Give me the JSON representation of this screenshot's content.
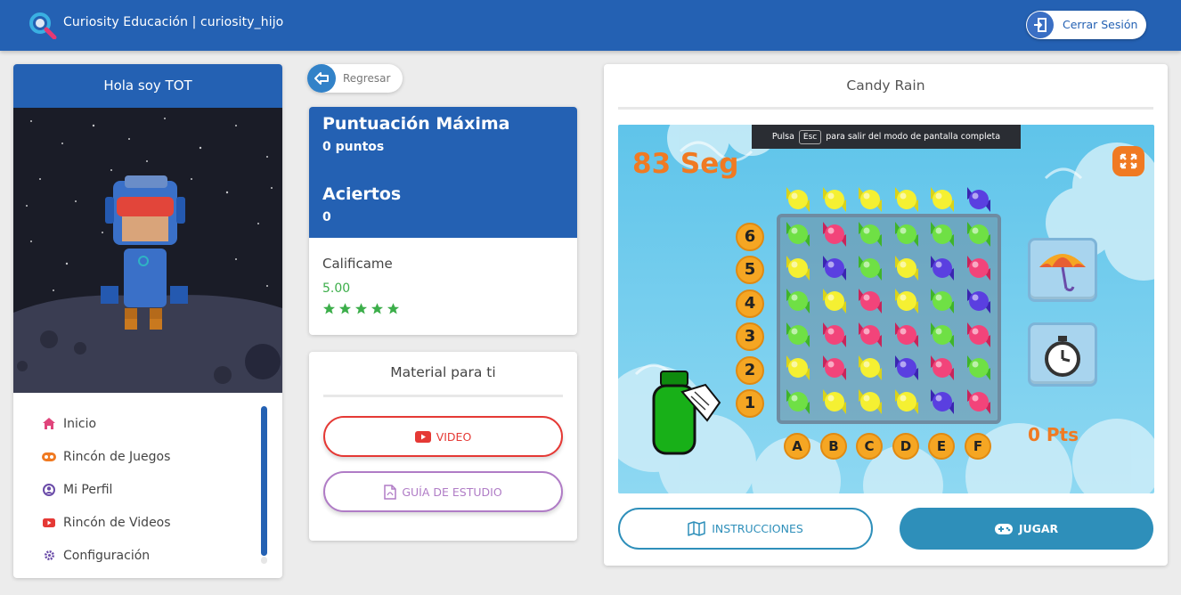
{
  "header": {
    "app_title": "Curiosity Educación | curiosity_hijo",
    "logout_label": "Cerrar Sesión"
  },
  "profile": {
    "greeting": "Hola soy TOT"
  },
  "nav": {
    "items": [
      {
        "label": "Inicio",
        "icon": "home-icon",
        "color": "#e0457b"
      },
      {
        "label": "Rincón de Juegos",
        "icon": "gamepad-icon",
        "color": "#f07a22"
      },
      {
        "label": "Mi Perfil",
        "icon": "user-circle-icon",
        "color": "#6a4ba8"
      },
      {
        "label": "Rincón de Videos",
        "icon": "youtube-icon",
        "color": "#e53935"
      },
      {
        "label": "Configuración",
        "icon": "gear-icon",
        "color": "#6a4ba8"
      }
    ]
  },
  "back": {
    "label": "Regresar"
  },
  "score": {
    "max_title": "Puntuación Máxima",
    "max_value": "0 puntos",
    "hits_title": "Aciertos",
    "hits_value": "0",
    "rate_label": "Calificame",
    "rate_value": "5.00",
    "stars": 5
  },
  "material": {
    "title": "Material para ti",
    "video_label": "VIDEO",
    "guide_label": "GUÍA DE ESTUDIO"
  },
  "game": {
    "title": "Candy Rain",
    "esc_prefix": "Pulsa",
    "esc_key": "Esc",
    "esc_suffix": "para salir del modo de pantalla completa",
    "timer": "83 Seg",
    "points": "0 Pts",
    "rows": [
      "6",
      "5",
      "4",
      "3",
      "2",
      "1"
    ],
    "cols": [
      "A",
      "B",
      "C",
      "D",
      "E",
      "F"
    ],
    "top_row": [
      "yellow",
      "yellow",
      "yellow",
      "yellow",
      "yellow",
      "blue"
    ],
    "grid": [
      [
        "green",
        "pink",
        "green",
        "green",
        "green",
        "green"
      ],
      [
        "yellow",
        "blue",
        "green",
        "yellow",
        "blue",
        "pink"
      ],
      [
        "green",
        "yellow",
        "pink",
        "yellow",
        "green",
        "blue"
      ],
      [
        "green",
        "pink",
        "pink",
        "pink",
        "green",
        "pink"
      ],
      [
        "yellow",
        "pink",
        "yellow",
        "blue",
        "pink",
        "green"
      ],
      [
        "green",
        "yellow",
        "yellow",
        "yellow",
        "blue",
        "pink"
      ]
    ],
    "instructions_label": "INSTRUCCIONES",
    "play_label": "JUGAR"
  },
  "colors": {
    "brand": "#2461b3",
    "accent_orange": "#f07a22",
    "rating_green": "#3cae4a",
    "video_red": "#e53935",
    "guide_purple": "#b07cc6",
    "play_teal": "#2e8fba"
  }
}
